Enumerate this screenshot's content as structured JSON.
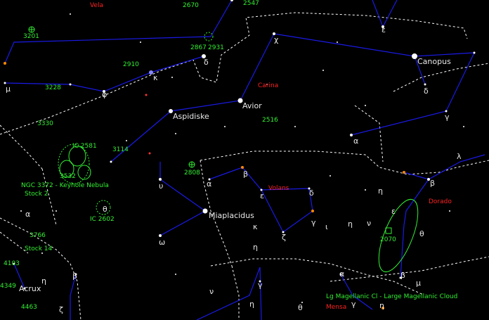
{
  "colors": {
    "background": "#000000",
    "lines": "#1a1ae6",
    "boundary": "#ffffff",
    "deep_sky": "#33ee33",
    "constellation_name": "#ff2222",
    "star_label": "#e8e8e8"
  },
  "constellations": [
    "Vela",
    "Carina",
    "Volans",
    "Dorado",
    "Mensa"
  ],
  "star_names": [
    "Canopus",
    "Avior",
    "Aspidiske",
    "Miaplacidus",
    "Acrux"
  ],
  "greek": [
    "ε",
    "χ",
    "δ",
    "κ",
    "φ",
    "μ",
    "δ",
    "γ",
    "α",
    "λ",
    "β",
    "η",
    "ε",
    "υ",
    "θ",
    "ω",
    "α",
    "β",
    "ε",
    "δ",
    "ζ",
    "κ",
    "η",
    "ι",
    "ν",
    "γ",
    "α",
    "β",
    "γ",
    "μ",
    "η",
    "ν",
    "η",
    "θ",
    "θ",
    "γ",
    "ζ",
    "η",
    "η",
    "α",
    "β"
  ],
  "deep_sky": [
    "2670",
    "2547",
    "3201",
    "2910",
    "3228",
    "3330",
    "3114",
    "2516",
    "2808",
    "2867",
    "2931",
    "NGC 3372 - Keyhole Nebula",
    "IC 2602",
    "3766",
    "4103",
    "4463",
    "2070",
    "Lg Magellanic Cl - Large Magellanic Cloud",
    "IC 2581",
    "Stock 14",
    "3532",
    "Stock 2",
    "4349"
  ]
}
